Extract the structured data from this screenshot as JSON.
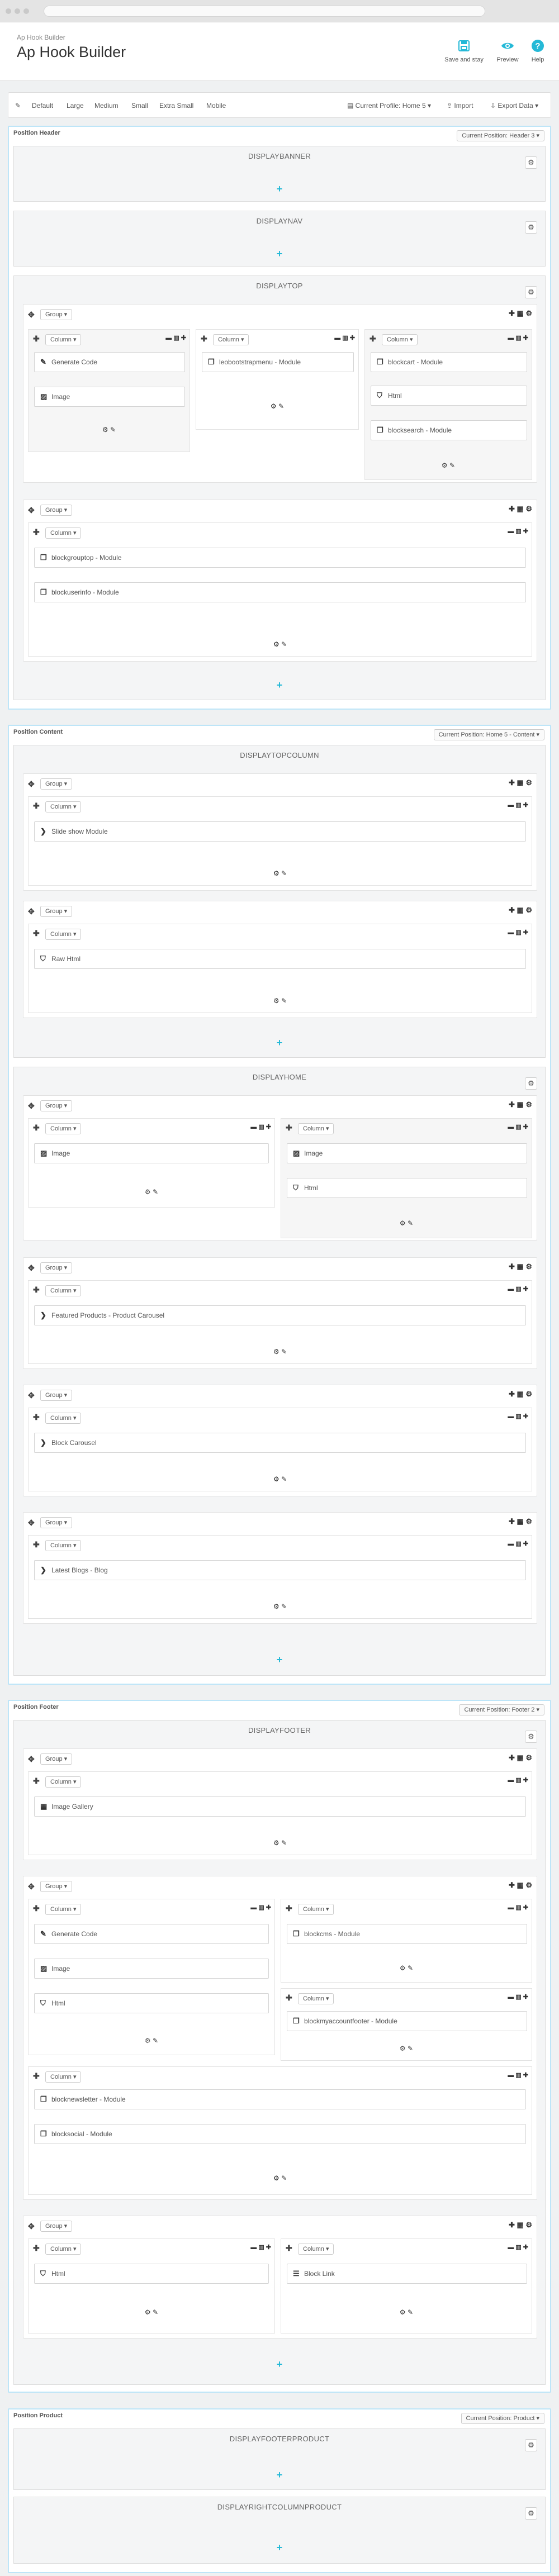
{
  "header": {
    "breadcrumb": "Ap Hook Builder",
    "title": "Ap Hook Builder",
    "toolbar": [
      {
        "label": "Save and stay",
        "icon": "save-icon"
      },
      {
        "label": "Preview",
        "icon": "eye-icon"
      },
      {
        "label": "Help",
        "icon": "help-icon"
      }
    ]
  },
  "devices": [
    "Default",
    "Large",
    "Medium",
    "Small",
    "Extra Small",
    "Mobile"
  ],
  "actions": {
    "profile": "Current Profile: Home 5",
    "import": "Import",
    "export": "Export Data"
  },
  "common": {
    "group": "Group",
    "column": "Column"
  },
  "panels": {
    "header": {
      "title": "Position Header",
      "position": "Current Position: Header 3",
      "hooks": [
        "DISPLAYBANNER",
        "DISPLAYNAV",
        "DISPLAYTOP"
      ],
      "w": [
        "Generate Code",
        "Image",
        "leobootstrapmenu - Module",
        "blockcart - Module",
        "Html",
        "blocksearch - Module",
        "blockgrouptop - Module",
        "blockuserinfo - Module"
      ]
    },
    "content": {
      "title": "Position Content",
      "position": "Current Position: Home 5 - Content",
      "hooks": [
        "DISPLAYTOPCOLUMN",
        "DISPLAYHOME"
      ],
      "w": [
        "Slide show Module",
        "Raw Html",
        "Image",
        "Image",
        "Html",
        "Featured Products - Product Carousel",
        "Block Carousel",
        "Latest Blogs - Blog"
      ]
    },
    "footer": {
      "title": "Position Footer",
      "position": "Current Position: Footer 2",
      "hooks": [
        "DISPLAYFOOTER"
      ],
      "w": [
        "Image Gallery",
        "Generate Code",
        "Image",
        "Html",
        "blockcms - Module",
        "blockmyaccountfooter - Module",
        "blocknewsletter - Module",
        "blocksocial - Module",
        "Html",
        "Block Link"
      ]
    },
    "product": {
      "title": "Position Product",
      "position": "Current Position: Product",
      "hooks": [
        "DISPLAYFOOTERPRODUCT",
        "DISPLAYRIGHTCOLUMNPRODUCT"
      ]
    }
  },
  "colors": {
    "accent": "#25b9d7",
    "panel_border": "#bde5f8"
  }
}
